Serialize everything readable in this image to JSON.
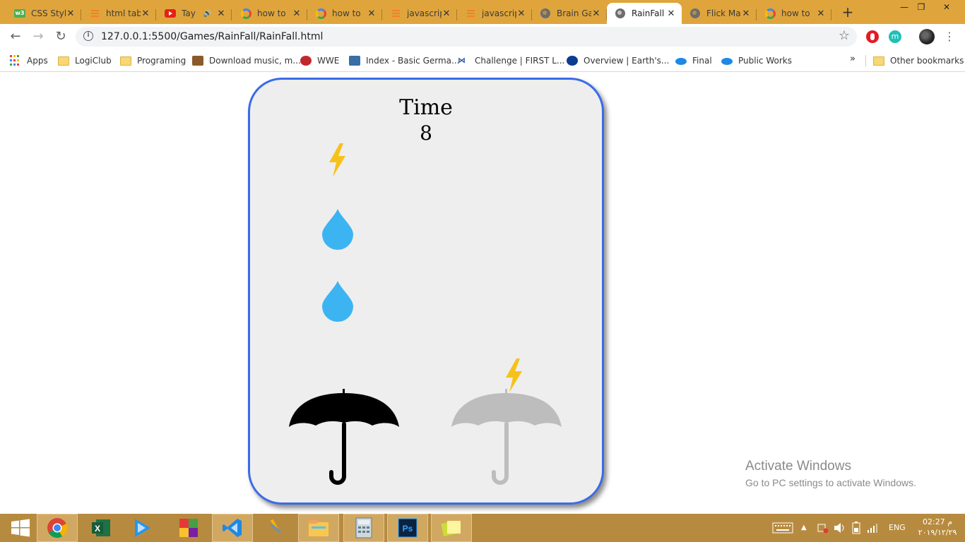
{
  "browser": {
    "tabs": [
      {
        "title": "CSS Styl",
        "icon": "w3schools-icon"
      },
      {
        "title": "html tab",
        "icon": "stackoverflow-icon"
      },
      {
        "title": "Tay",
        "icon": "youtube-icon",
        "audio": "🔊"
      },
      {
        "title": "how to",
        "icon": "google-icon"
      },
      {
        "title": "how to",
        "icon": "google-icon"
      },
      {
        "title": "javascrip",
        "icon": "stackoverflow-icon"
      },
      {
        "title": "javascrip",
        "icon": "stackoverflow-icon"
      },
      {
        "title": "Brain Ga",
        "icon": "globe-icon"
      },
      {
        "title": "RainFall",
        "icon": "globe-icon",
        "active": true
      },
      {
        "title": "Flick Ma",
        "icon": "globe-icon"
      },
      {
        "title": "how to",
        "icon": "google-icon"
      }
    ],
    "new_tab": "+",
    "window_controls": {
      "minimize": "—",
      "restore": "❐",
      "close": "✕"
    },
    "toolbar": {
      "back": "←",
      "forward": "→",
      "reload": "↻",
      "star": "☆",
      "menu": "⋮",
      "extension_m": "m"
    },
    "url": "127.0.0.1:5500/Games/RainFall/RainFall.html",
    "bookmarks": [
      {
        "label": "Apps",
        "icon": "apps-grid-icon"
      },
      {
        "label": "LogiClub",
        "icon": "folder-icon"
      },
      {
        "label": "Programing",
        "icon": "folder-icon"
      },
      {
        "label": "Download music, m...",
        "icon": "site-icon"
      },
      {
        "label": "WWE",
        "icon": "site-icon"
      },
      {
        "label": "Index - Basic Germa...",
        "icon": "site-icon"
      },
      {
        "label": "Challenge | FIRST L...",
        "icon": "site-icon"
      },
      {
        "label": "Overview | Earth's...",
        "icon": "nasa-icon"
      },
      {
        "label": "Final",
        "icon": "site-icon"
      },
      {
        "label": "Public Works",
        "icon": "site-icon"
      }
    ],
    "bookmarks_overflow": "»",
    "other_bookmarks": "Other bookmarks"
  },
  "game": {
    "time_label": "Time",
    "time_value": "8",
    "falling_items": [
      {
        "kind": "lightning"
      },
      {
        "kind": "raindrop"
      },
      {
        "kind": "raindrop"
      },
      {
        "kind": "lightning"
      }
    ],
    "umbrellas": [
      {
        "state": "selected",
        "color": "#000000"
      },
      {
        "state": "unselected",
        "color": "#bdbdbd"
      }
    ],
    "colors": {
      "raindrop": "#3cb4f2",
      "lightning": "#f6c21a",
      "border": "#3a6be8",
      "panel": "#eeeeee"
    }
  },
  "watermark": {
    "title": "Activate Windows",
    "subtitle": "Go to PC settings to activate Windows."
  },
  "taskbar": {
    "apps": [
      "windows-start-icon",
      "chrome-icon",
      "excel-icon",
      "media-player-icon",
      "office-icon",
      "vscode-icon",
      "tools-icon",
      "file-explorer-icon",
      "calculator-icon",
      "photoshop-icon",
      "sticky-notes-icon"
    ],
    "language": "ENG",
    "time": "02:27 م",
    "date": "٢٠١٩/١٢/٢٩"
  }
}
